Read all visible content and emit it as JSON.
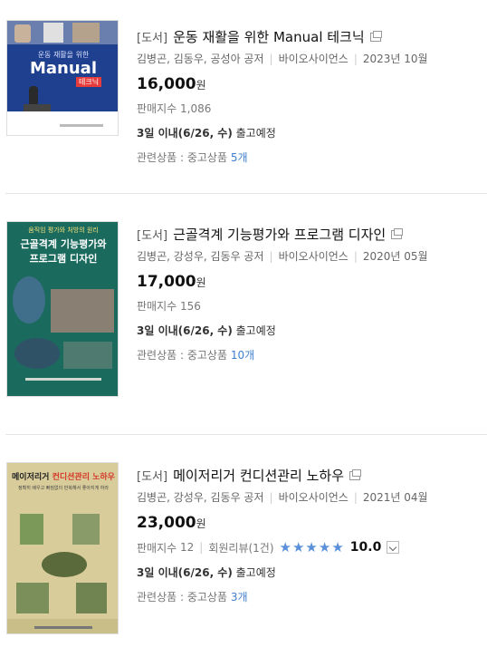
{
  "items": [
    {
      "category": "[도서]",
      "title": "운동 재활을 위한 Manual 테크닉",
      "authors": "김병곤, 김동우, 공성아 공저",
      "publisher": "바이오사이언스",
      "date": "2023년 10월",
      "price": "16,000",
      "price_unit": "원",
      "sales_label": "판매지수",
      "sales_value": "1,086",
      "ship_bold": "3일 이내(6/26, 수)",
      "ship_text": " 출고예정",
      "related_label": "관련상품 : 중고상품 ",
      "related_count": "5개",
      "cover": {
        "top_text": "운동 재활을 위한",
        "main_text": "Manual",
        "badge": "테크닉",
        "color": "#1f3f8f"
      }
    },
    {
      "category": "[도서]",
      "title": "근골격계 기능평가와 프로그램 디자인",
      "authors": "김병곤, 강성우, 김동우 공저",
      "publisher": "바이오사이언스",
      "date": "2020년 05월",
      "price": "17,000",
      "price_unit": "원",
      "sales_label": "판매지수",
      "sales_value": "156",
      "ship_bold": "3일 이내(6/26, 수)",
      "ship_text": " 출고예정",
      "related_label": "관련상품 : 중고상품 ",
      "related_count": "10개",
      "cover": {
        "top_text": "움직임 평가와 처방의 원리",
        "main_text": "근골격계 기능평가와",
        "sub_text": "프로그램 디자인",
        "color": "#1b6a5e"
      }
    },
    {
      "category": "[도서]",
      "title": "메이저리거 컨디션관리 노하우",
      "authors": "김병곤, 강성우, 김동우 공저",
      "publisher": "바이오사이언스",
      "date": "2021년 04월",
      "price": "23,000",
      "price_unit": "원",
      "sales_label": "판매지수",
      "sales_value": "12",
      "review_label": "회원리뷰(1건)",
      "stars": "★★★★★",
      "rating": "10.0",
      "ship_bold": "3일 이내(6/26, 수)",
      "ship_text": " 출고예정",
      "related_label": "관련상품 : 중고상품 ",
      "related_count": "3개",
      "cover": {
        "main_text": "메이저리거",
        "accent_text": "컨디션관리 노하우",
        "sub_text": "정확히 배우고 빠짐없이 반복해서 좋아지게 하라",
        "color": "#d8cc9a"
      }
    }
  ]
}
